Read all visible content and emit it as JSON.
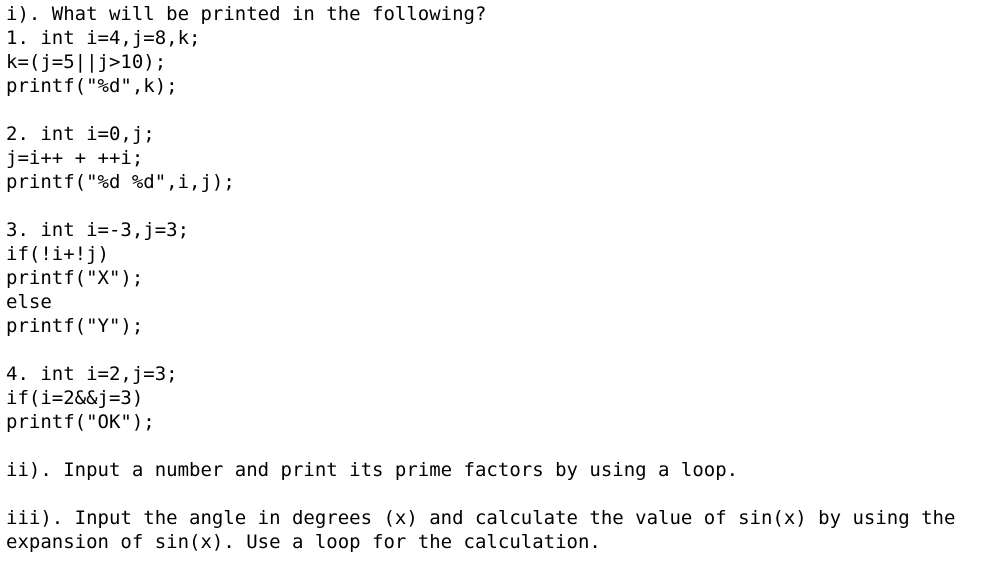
{
  "q1": {
    "heading": "i). What will be printed in the following?",
    "part1": [
      "1. int i=4,j=8,k;",
      "k=(j=5||j>10);",
      "printf(\"%d\",k);"
    ],
    "part2": [
      "2. int i=0,j;",
      "j=i++ + ++i;",
      "printf(\"%d %d\",i,j);"
    ],
    "part3": [
      "3. int i=-3,j=3;",
      "if(!i+!j)",
      "printf(\"X\");",
      "else",
      "printf(\"Y\");"
    ],
    "part4": [
      "4. int i=2,j=3;",
      "if(i=2&&j=3)",
      "printf(\"OK\");"
    ]
  },
  "q2": {
    "text": "ii). Input a number and print its prime factors by using a loop."
  },
  "q3": {
    "text": "iii). Input the angle in degrees (x) and calculate the value of sin(x) by using the expansion of sin(x). Use a loop for the calculation."
  }
}
